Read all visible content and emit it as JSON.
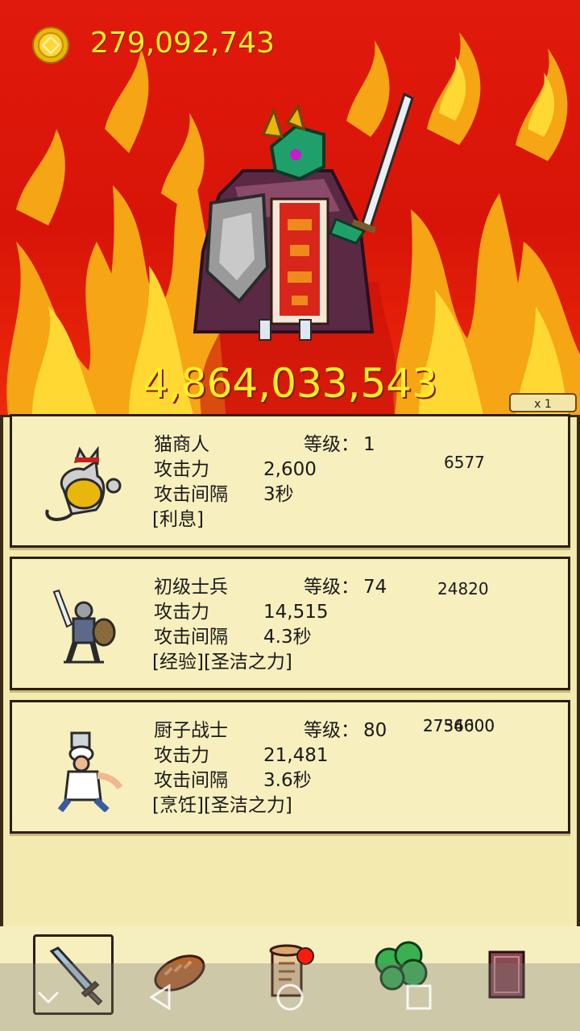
{
  "game": {
    "gold": "279,092,743",
    "boss_hp": "4,864,033,543",
    "speed_label": "x 1"
  },
  "labels": {
    "level": "等级：",
    "attack": "攻击力",
    "interval": "攻击间隔"
  },
  "units": [
    {
      "name": "猫商人",
      "level": "1",
      "attack": "2,600",
      "interval": "3秒",
      "tags": "[利息]",
      "cost": "6577",
      "portrait": "cat-merchant-icon"
    },
    {
      "name": "初级士兵",
      "level": "74",
      "attack": "14,515",
      "interval": "4.3秒",
      "tags": "[经验][圣洁之力]",
      "cost": "24820",
      "portrait": "soldier-icon"
    },
    {
      "name": "厨子战士",
      "level": "80",
      "attack": "21,481",
      "interval": "3.6秒",
      "tags": "[烹饪][圣洁之力]",
      "cost_overlap_a": "2734600",
      "cost_overlap_b": "2756000",
      "portrait": "chef-warrior-icon"
    }
  ],
  "toolbar": [
    {
      "icon": "sword-icon",
      "active": true
    },
    {
      "icon": "bread-icon",
      "active": false
    },
    {
      "icon": "scroll-icon",
      "active": false,
      "badge": true
    },
    {
      "icon": "clover-icon",
      "active": false
    },
    {
      "icon": "book-icon",
      "active": false
    }
  ],
  "system_nav": [
    "chevron-down-icon",
    "back-icon",
    "home-icon",
    "recent-apps-icon"
  ],
  "colors": {
    "gold_text": "#ffef2a",
    "fire_red": "#d81408",
    "panel_bg": "#f3eab0",
    "card_border": "#2c1f0f",
    "badge_red": "#ff1a10"
  }
}
